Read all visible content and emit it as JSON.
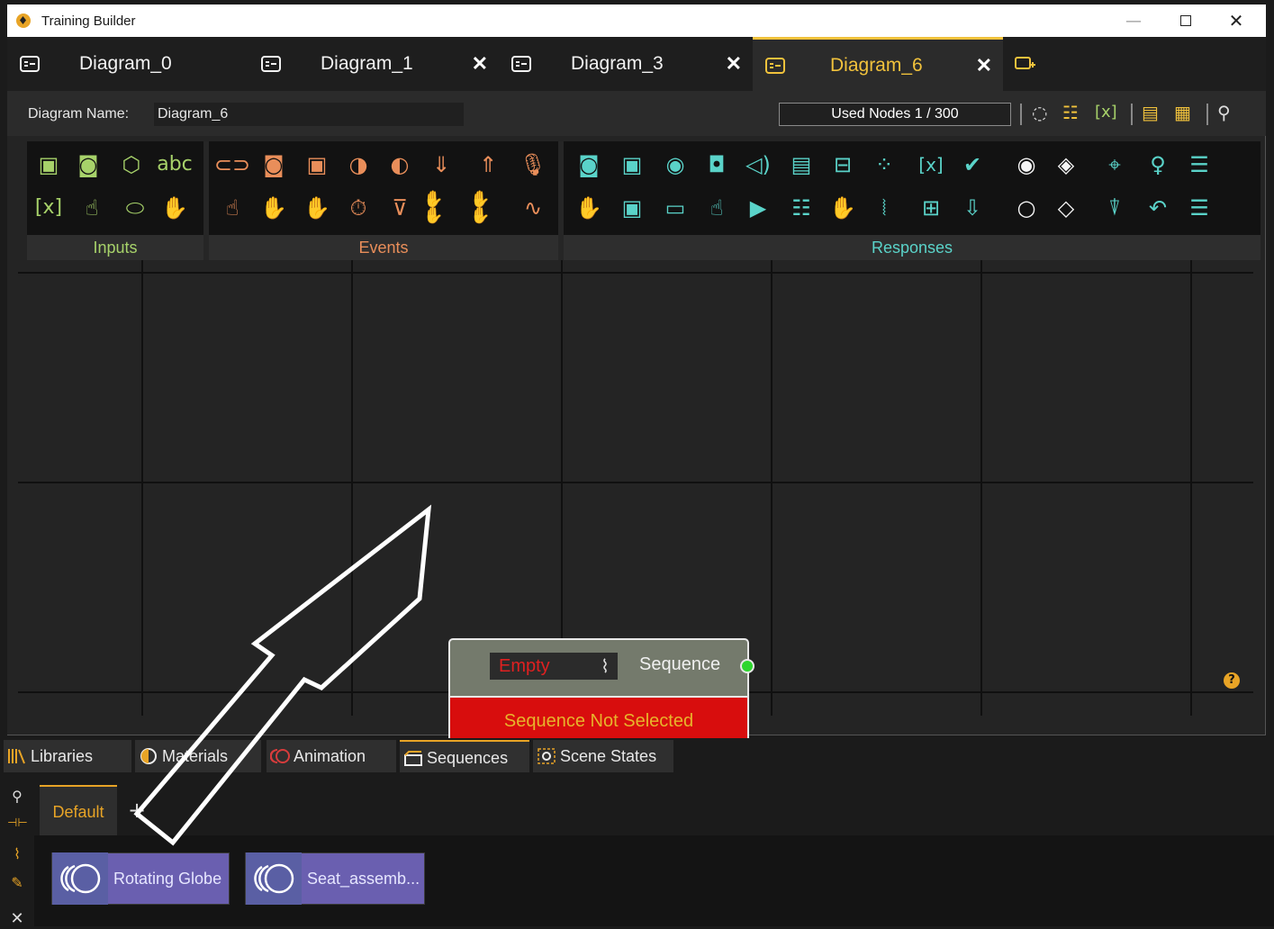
{
  "window": {
    "title": "Training Builder"
  },
  "tabs": [
    {
      "label": "Diagram_0",
      "closable": false,
      "active": false
    },
    {
      "label": "Diagram_1",
      "closable": true,
      "active": false
    },
    {
      "label": "Diagram_3",
      "closable": true,
      "active": false
    },
    {
      "label": "Diagram_6",
      "closable": true,
      "active": true
    }
  ],
  "info": {
    "diagram_name_label": "Diagram Name:",
    "diagram_name_value": "Diagram_6",
    "used_nodes": "Used Nodes 1 / 300"
  },
  "palette": {
    "groups": [
      {
        "label": "Inputs",
        "color": "#a7d26a"
      },
      {
        "label": "Events",
        "color": "#e98e5a"
      },
      {
        "label": "Responses",
        "color": "#5ad3c9"
      }
    ],
    "input_text_icon": "abc",
    "var_icon": "[x]"
  },
  "node": {
    "field_value": "Empty",
    "output_label": "Sequence",
    "error_message": "Sequence Not Selected"
  },
  "bottom_tabs": [
    {
      "label": "Libraries"
    },
    {
      "label": "Materials"
    },
    {
      "label": "Animation"
    },
    {
      "label": "Sequences",
      "active": true
    },
    {
      "label": "Scene States"
    }
  ],
  "sub_tabs": [
    {
      "label": "Default"
    }
  ],
  "sequences": [
    {
      "label": "Rotating Globe"
    },
    {
      "label": "Seat_assemb..."
    }
  ],
  "colors": {
    "accent": "#e8a426",
    "node_error": "#d80d0d",
    "port_connected": "#2dd62d"
  }
}
